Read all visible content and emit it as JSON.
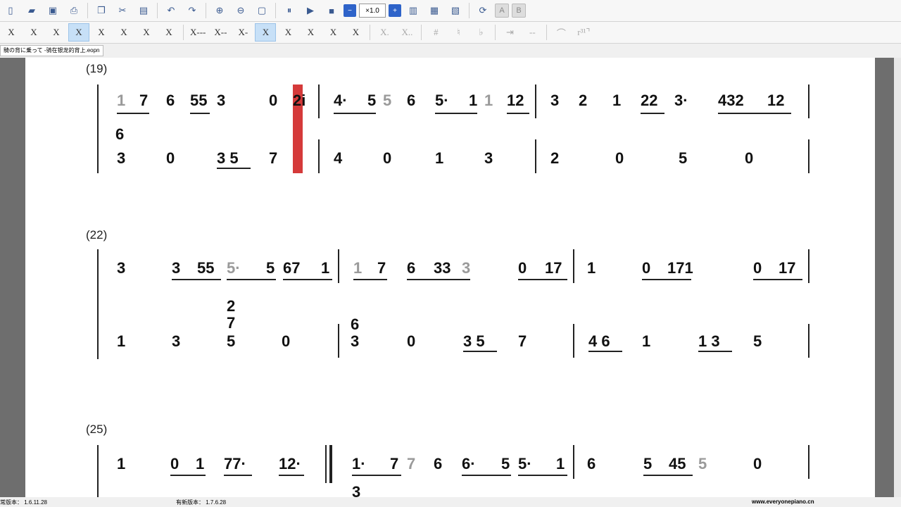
{
  "toolbar1": {
    "zoom_label": "×1.0"
  },
  "toolbar2": {
    "notes": [
      "X",
      "X",
      "X",
      "X",
      "X",
      "X",
      "X",
      "X",
      "X---",
      "X--",
      "X-",
      "X",
      "X",
      "X",
      "X",
      "X",
      "X.",
      "X..",
      "#",
      "♮",
      "♭",
      "⇥",
      "--",
      "⌒",
      "r³¹⌝"
    ]
  },
  "file_tab": "騎の背に乗って -骑在银龙的背上.eopn",
  "score": {
    "measures": [
      "(19)",
      "(22)",
      "(25)"
    ]
  },
  "status": {
    "current_version": "常版本：  1.6.11.28",
    "new_version": "有新版本：  1.7.6.28",
    "site": "www.everyonepiano.cn"
  }
}
